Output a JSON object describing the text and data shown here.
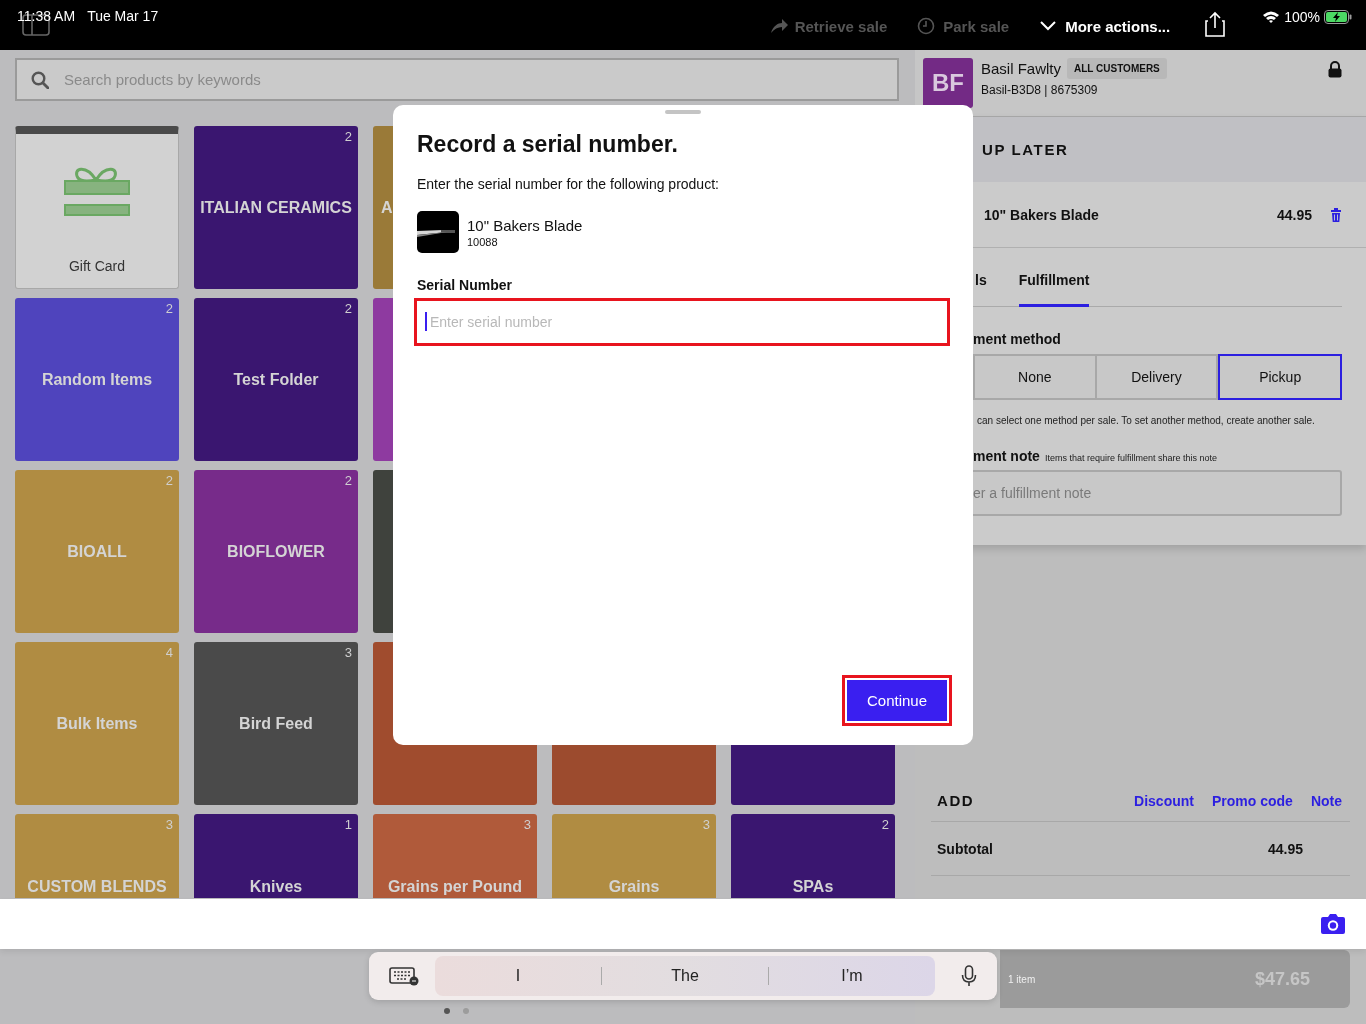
{
  "status_bar": {
    "time": "11:38 AM",
    "date": "Tue Mar 17",
    "battery": "100%"
  },
  "toolbar": [
    {
      "kind": "retrieve",
      "label": "Retrieve sale",
      "disabled": true
    },
    {
      "kind": "park",
      "label": "Park sale",
      "disabled": true
    },
    {
      "kind": "more",
      "label": "More actions...",
      "disabled": false
    }
  ],
  "search": {
    "placeholder": "Search products by keywords"
  },
  "tile_rows": [
    [
      {
        "kind": "gift",
        "label": "Gift Card",
        "color": "#d2d2d2"
      },
      {
        "kind": "folder",
        "label": "ITALIAN CERAMICS",
        "count": "2",
        "color": "#3a1670"
      },
      {
        "kind": "folder",
        "label": "A",
        "color": "#9a7a38"
      }
    ],
    [
      {
        "kind": "folder",
        "label": "Random Items",
        "count": "2",
        "color": "#4f44bd"
      },
      {
        "kind": "folder",
        "label": "Test Folder",
        "count": "2",
        "color": "#3a1670"
      },
      {
        "kind": "folder",
        "color": "#8e3aa0"
      }
    ],
    [
      {
        "kind": "folder",
        "label": "BIOALL",
        "count": "2",
        "color": "#b08c42"
      },
      {
        "kind": "folder",
        "label": "BIOFLOWER",
        "count": "2",
        "color": "#772b8a"
      },
      {
        "kind": "folder",
        "color": "#3f423d"
      }
    ],
    [
      {
        "kind": "folder",
        "label": "Bulk Items",
        "count": "4",
        "color": "#b08c42"
      },
      {
        "kind": "folder",
        "label": "Bird Feed",
        "count": "3",
        "color": "#4a4a4a"
      },
      {
        "kind": "folder",
        "color": "#a04c2e"
      },
      {
        "kind": "folder",
        "color": "#9c4b2e"
      },
      {
        "kind": "folder",
        "color": "#3a1670"
      }
    ],
    [
      {
        "kind": "folder",
        "label": "CUSTOM BLENDS",
        "count": "3",
        "color": "#b08c42"
      },
      {
        "kind": "folder",
        "label": "Knives",
        "count": "1",
        "color": "#3a1670"
      },
      {
        "kind": "folder",
        "label": "Grains per Pound",
        "count": "3",
        "color": "#b05a3a"
      },
      {
        "kind": "folder",
        "label": "Grains",
        "count": "3",
        "color": "#b08c42"
      },
      {
        "kind": "folder",
        "label": "SPAs",
        "count": "2",
        "color": "#3a1670"
      }
    ]
  ],
  "customer": {
    "initials": "BF",
    "name": "Basil Fawlty",
    "group": "ALL CUSTOMERS",
    "detail": "Basil-B3D8 | 8675309"
  },
  "sale": {
    "header": "UP LATER",
    "items": [
      {
        "name": "10\" Bakers Blade",
        "price": "44.95"
      }
    ],
    "tabs": [
      {
        "label": "ls",
        "selected": false
      },
      {
        "label": "Fulfillment",
        "selected": true
      }
    ],
    "method_label": "ment method",
    "methods": [
      {
        "label": "None",
        "selected": false
      },
      {
        "label": "Delivery",
        "selected": false
      },
      {
        "label": "Pickup",
        "selected": true
      }
    ],
    "method_help": "can select one method per sale. To set another method, create another sale.",
    "note_label": "ment note",
    "note_hint": "Items that require fulfillment share this note",
    "note_placeholder": "er a fulfillment note",
    "add_label": "ADD",
    "add_links": [
      "Discount",
      "Promo code",
      "Note"
    ],
    "totals": [
      {
        "label": "Subtotal",
        "value": "44.95"
      }
    ],
    "charge": {
      "items": "1 item",
      "amount": "$47.65"
    }
  },
  "modal": {
    "title": "Record a serial number.",
    "prompt": "Enter the serial number for the following product:",
    "product": {
      "name": "10\" Bakers Blade",
      "sku": "10088"
    },
    "field_label": "Serial Number",
    "field_placeholder": "Enter serial number",
    "button": "Continue"
  },
  "keyboard": {
    "suggestions": [
      "I",
      "The",
      "I’m"
    ]
  },
  "page_dots": [
    {
      "selected": true
    },
    {
      "selected": false
    }
  ]
}
